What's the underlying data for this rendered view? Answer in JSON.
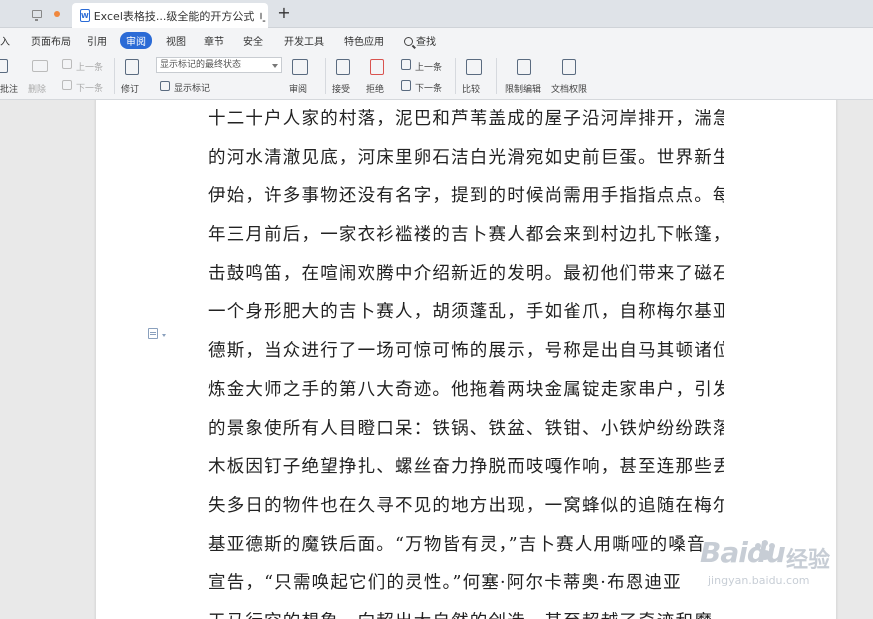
{
  "tabs": {
    "active_title": "Excel表格技...级全能的开方公式",
    "new_tab": "+"
  },
  "menu": {
    "items": [
      "入",
      "页面布局",
      "引用",
      "审阅",
      "视图",
      "章节",
      "安全",
      "开发工具",
      "特色应用"
    ],
    "active": "审阅",
    "search": "查找"
  },
  "toolbar": {
    "annotate": "批注",
    "delete": "删除",
    "prev": "上一条",
    "next": "下一条",
    "revise": "修订",
    "display_state": "显示标记的最终状态",
    "show_marks": "显示标记",
    "review": "审阅",
    "accept": "接受",
    "reject": "拒绝",
    "prev2": "上一条",
    "next2": "下一条",
    "compare": "比较",
    "restrict": "限制编辑",
    "doc_rights": "文档权限"
  },
  "document": {
    "lines": [
      "十二十户人家的村落，泥巴和芦苇盖成的屋子沿河岸排开，湍急",
      "的河水清澈见底，河床里卵石洁白光滑宛如史前巨蛋。世界新生",
      "伊始，许多事物还没有名字，提到的时候尚需用手指指点点。每",
      "年三月前后，一家衣衫褴褛的吉卜赛人都会来到村边扎下帐篷，",
      "击鼓鸣笛，在喧闹欢腾中介绍新近的发明。最初他们带来了磁石。",
      "一个身形肥大的吉卜赛人，胡须蓬乱，手如雀爪，自称梅尔基亚",
      "德斯，当众进行了一场可惊可怖的展示，号称是出自马其顿诸位",
      "炼金大师之手的第八大奇迹。他拖着两块金属锭走家串户，引发",
      "的景象使所有人目瞪口呆：铁锅、铁盆、铁钳、小铁炉纷纷跌落，",
      "木板因钉子绝望挣扎、螺丝奋力挣脱而吱嘎作响，甚至连那些丢",
      "失多日的物件也在久寻不见的地方出现，一窝蜂似的追随在梅尔",
      "基亚德斯的魔铁后面。“万物皆有灵，”吉卜赛人用嘶哑的嗓音",
      "宣告，“只需唤起它们的灵性。”何塞·阿尔卡蒂奥·布恩迪亚",
      "天马行空的想象一向超出大自然的创造，甚至超越了奇迹和魔"
    ]
  },
  "watermark": {
    "logo": "Baidu",
    "text": "经验",
    "url": "jingyan.baidu.com"
  }
}
